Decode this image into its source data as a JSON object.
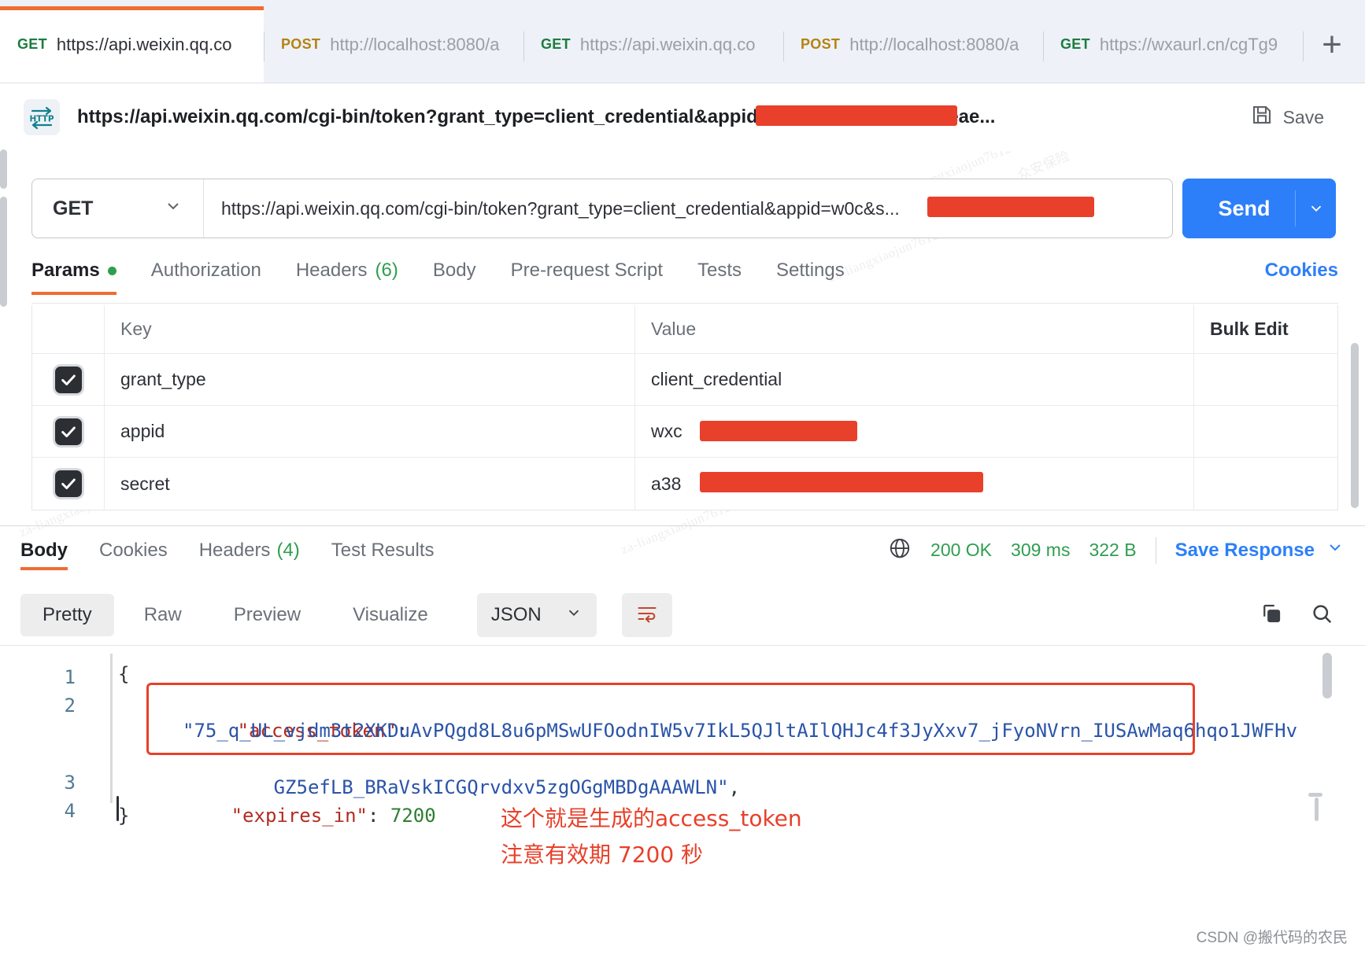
{
  "tabs": [
    {
      "method": "GET",
      "url": "https://api.weixin.qq.co",
      "active": true
    },
    {
      "method": "POST",
      "url": "http://localhost:8080/a",
      "active": false
    },
    {
      "method": "GET",
      "url": "https://api.weixin.qq.co",
      "active": false
    },
    {
      "method": "POST",
      "url": "http://localhost:8080/a",
      "active": false
    },
    {
      "method": "GET",
      "url": "https://wxaurl.cn/cgTg9",
      "active": false
    }
  ],
  "newtab_label": "+",
  "request": {
    "protocol_badge": "HTTP",
    "title_prefix": "https://api.weixin.qq.com/cgi-bin/token?grant_type=client_credential&appid=wxc42",
    "title_suffix": "c&secret=a38eae...",
    "save_label": "Save",
    "method": "GET",
    "url_prefix": "https://api.weixin.qq.com/cgi-bin/token?grant_type=client_credential&appid=w",
    "url_suffix": "0c&s...",
    "send_label": "Send"
  },
  "request_tabs": [
    {
      "label": "Params",
      "active": true,
      "dot": true
    },
    {
      "label": "Authorization",
      "active": false
    },
    {
      "label": "Headers",
      "count": "(6)",
      "active": false
    },
    {
      "label": "Body",
      "active": false
    },
    {
      "label": "Pre-request Script",
      "active": false
    },
    {
      "label": "Tests",
      "active": false
    },
    {
      "label": "Settings",
      "active": false
    }
  ],
  "cookies_link": "Cookies",
  "params_table": {
    "headers": {
      "key": "Key",
      "value": "Value",
      "bulk": "Bulk Edit"
    },
    "rows": [
      {
        "checked": true,
        "key": "grant_type",
        "value": "client_credential",
        "redacted": false
      },
      {
        "checked": true,
        "key": "appid",
        "value": "wxc",
        "redacted": true,
        "redact_width": 200
      },
      {
        "checked": true,
        "key": "secret",
        "value": "a38",
        "redacted": true,
        "redact_width": 360
      }
    ]
  },
  "response": {
    "tabs": [
      {
        "label": "Body",
        "active": true
      },
      {
        "label": "Cookies",
        "active": false
      },
      {
        "label": "Headers",
        "count": "(4)",
        "active": false
      },
      {
        "label": "Test Results",
        "active": false
      }
    ],
    "status": "200 OK",
    "time": "309 ms",
    "size": "322 B",
    "save_response_label": "Save Response",
    "view_tabs": [
      {
        "label": "Pretty",
        "active": true
      },
      {
        "label": "Raw",
        "active": false
      },
      {
        "label": "Preview",
        "active": false
      },
      {
        "label": "Visualize",
        "active": false
      }
    ],
    "format": "JSON"
  },
  "code": {
    "lines": [
      "1",
      "2",
      "3",
      "4"
    ],
    "open_brace": "{",
    "close_brace": "}",
    "token_key": "\"access_token\"",
    "token_colon": ":",
    "token_value_line1": "\"75_q_UL_vjdm3t2XKDuAvPQgd8L8u6pMSwUFOodnIW5v7IkL5QJltAIlQHJc4f3JyXxv7_jFyoNVrn_IUSAwMaq6hqo1JWFHv",
    "token_value_line2": "GZ5efLB_BRaVskICGQrvdxv5zgOGgMBDgAAAWLN\"",
    "token_comma": ",",
    "expires_key": "\"expires_in\"",
    "expires_colon": ":",
    "expires_value": "7200"
  },
  "annotation": {
    "line1": "这个就是生成的access_token",
    "line2": "注意有效期 7200 秒"
  },
  "watermarks": [
    "za-liangxiaojun7612",
    "众安保险",
    "za-liangxiaojun7612",
    "众安保险",
    "za-liangxiaojun7612",
    "众安保险",
    "za-liangxiaojun7612",
    "众安保险",
    "za-liangxiaojun7612",
    "众安保险",
    "za-liangxiaojun7612"
  ],
  "footer": "CSDN @搬代码的农民",
  "colors": {
    "accent_orange": "#ef6c33",
    "link_blue": "#2d7ff9",
    "status_green": "#2f9e4f",
    "redact_red": "#e8402a",
    "get_green": "#1d7c3f",
    "post_yellow": "#b48313"
  }
}
